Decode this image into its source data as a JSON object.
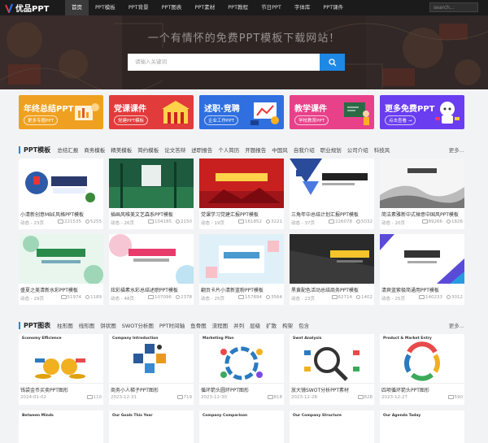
{
  "nav": {
    "logo": "优品PPT",
    "items": [
      "首页",
      "PPT模板",
      "PPT背景",
      "PPT图表",
      "PPT素材",
      "PPT教程",
      "节日PPT",
      "字体库",
      "PPT课件"
    ],
    "search_placeholder": "search..."
  },
  "hero": {
    "title": "一个有情怀的免费PPT模板下载网站！",
    "search_placeholder": "请输入关键词"
  },
  "banners": [
    {
      "title": "年终总结PPT",
      "tag": "更多专题PPT",
      "color": "#f0a020"
    },
    {
      "title": "党课课件",
      "tag": "党建PPT模板",
      "color": "#e23b3b"
    },
    {
      "title": "述职·竞聘",
      "tag": "企业工作PPT",
      "color": "#2f6fe0"
    },
    {
      "title": "教学课件",
      "tag": "学校教育PPT",
      "color": "#e8418a"
    },
    {
      "title": "更多免费PPT",
      "tag": "点击查看 →",
      "color": "#6a3df0"
    }
  ],
  "ppt_templates": {
    "title": "PPT模板",
    "tags": [
      "总结汇报",
      "商务模板",
      "精美模板",
      "简约模板",
      "论文答辩",
      "述职报告",
      "个人简历",
      "开题报告",
      "中国风",
      "自我介绍",
      "职业规划",
      "公司介绍",
      "科技风"
    ],
    "more": "更多...",
    "cards": [
      {
        "title": "小清新创意MBE风格PPT模板",
        "meta_left": "动态 - 23页",
        "views": "221535",
        "likes": "5255"
      },
      {
        "title": "插画风唯美文艺森系PPT模板",
        "meta_left": "动态 - 26页",
        "views": "104185",
        "likes": "2150"
      },
      {
        "title": "党课学习党建汇报PPT模板",
        "meta_left": "动态 - 19页",
        "views": "161852",
        "likes": "3221"
      },
      {
        "title": "三角年中总结计划汇报PPT模板",
        "meta_left": "动态 - 37页",
        "views": "226078",
        "likes": "5032"
      },
      {
        "title": "简洁素雅新中式禅意中国风PPT模板",
        "meta_left": "动态 - 20页",
        "views": "89266",
        "likes": "1826"
      },
      {
        "title": "盛夏之美清新水彩PPT模板",
        "meta_left": "动态 - 29页",
        "views": "51974",
        "likes": "1189"
      },
      {
        "title": "炫彩描素水彩总结述职PPT模板",
        "meta_left": "动态 - 48页",
        "views": "107096",
        "likes": "2378"
      },
      {
        "title": "翻页卡片小清新蓝粉PPT模板",
        "meta_left": "动态 - 25页",
        "views": "157894",
        "likes": "3564"
      },
      {
        "title": "黑黄配色活动总结商务PPT模板",
        "meta_left": "动态 - 23页",
        "views": "62714",
        "likes": "1402"
      },
      {
        "title": "清爽蓝紫极简通用PPT模板",
        "meta_left": "动态 - 25页",
        "views": "140233",
        "likes": "3012"
      }
    ]
  },
  "ppt_charts": {
    "title": "PPT图表",
    "tags": [
      "柱形图",
      "线形图",
      "饼状图",
      "SWOT分析图",
      "PPT时间轴",
      "鱼骨图",
      "流程图",
      "并列",
      "层级",
      "扩散",
      "构架",
      "包含"
    ],
    "more": "更多...",
    "cards": [
      {
        "title": "钱袋金币买卖PPT图形",
        "meta_left": "2024-01-02",
        "views": "110",
        "thumb_label": "Economy Efficience"
      },
      {
        "title": "商务小人梯子PPT图形",
        "meta_left": "2023-12-31",
        "views": "719",
        "thumb_label": "Company Introduction"
      },
      {
        "title": "循环箭头圆环PPT图形",
        "meta_left": "2023-12-30",
        "views": "818",
        "thumb_label": "Marketing Plan"
      },
      {
        "title": "放大镜SWOT分析PPT素材",
        "meta_left": "2023-12-28",
        "views": "828",
        "thumb_label": "Swot Analysis"
      },
      {
        "title": "四项循环箭头PPT图形",
        "meta_left": "2023-12-27",
        "views": "590",
        "thumb_label": "Product & Market Entry"
      }
    ],
    "next_labels": [
      "Between Minds",
      "Our Goals This Year",
      "Company Comparison",
      "Our Company Structure",
      "Our Agenda Today"
    ]
  }
}
